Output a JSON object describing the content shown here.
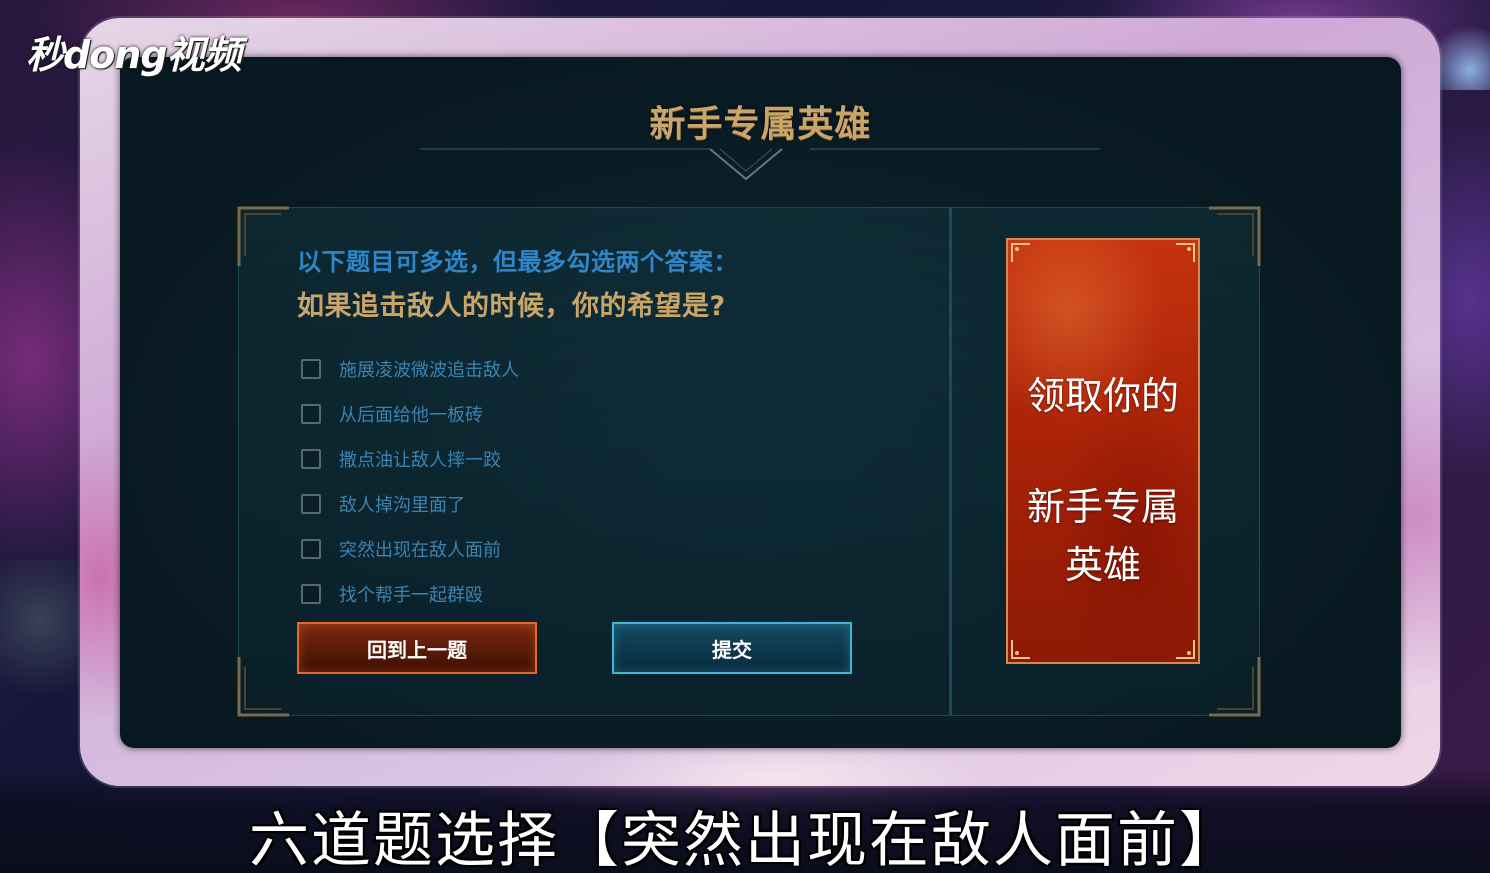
{
  "watermark": {
    "text": "秒dong视频"
  },
  "panel": {
    "title": "新手专属英雄"
  },
  "quiz": {
    "instruction": "以下题目可多选，但最多勾选两个答案：",
    "question": "如果追击敌人的时候，你的希望是?",
    "options": [
      {
        "label": "施展凌波微波追击敌人",
        "checked": false
      },
      {
        "label": "从后面给他一板砖",
        "checked": false
      },
      {
        "label": "撒点油让敌人摔一跤",
        "checked": false
      },
      {
        "label": "敌人掉沟里面了",
        "checked": false
      },
      {
        "label": "突然出现在敌人面前",
        "checked": false
      },
      {
        "label": "找个帮手一起群殴",
        "checked": false
      }
    ],
    "back_button": "回到上一题",
    "submit_button": "提交"
  },
  "reward": {
    "line1": "领取你的",
    "line2": "新手专属英雄"
  },
  "subtitle": {
    "text": "六道题选择【突然出现在敌人面前】"
  },
  "colors": {
    "gold": "#c9a56a",
    "blue_text": "#2f86c8",
    "option_text": "#3c83b0",
    "back_button_border": "#e06a2e",
    "submit_button_border": "#3fb6d6",
    "reward_red": "#b4280a"
  }
}
